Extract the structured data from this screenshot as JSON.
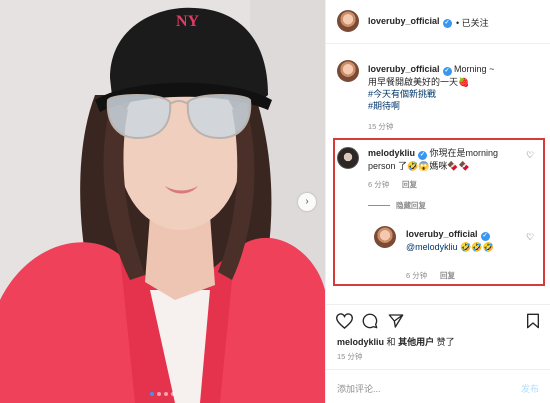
{
  "photo": {
    "colors": {
      "jacket": "#f0415a",
      "cap": "#1b1b1b",
      "cap_logo": "#e23a63",
      "hair": "#3a2620",
      "skin": "#f0cfbe",
      "background": "#e6e2e1"
    },
    "nav_icon": "chevron-right-icon",
    "slide_count": 4,
    "active_slide": 1
  },
  "header": {
    "username": "loveruby_official",
    "separator": "•",
    "follow_status": "已关注"
  },
  "caption": {
    "username": "loveruby_official",
    "lines": [
      "Morning ~",
      "用早餐開啟美好的一天🍓",
      "#今天有個新挑戰",
      "#期待啊"
    ],
    "time": "15 分钟"
  },
  "comments": [
    {
      "username": "melodykliu",
      "text_line1": "你現在是morning",
      "text_line2": "person 了🤣😱媽咪🍫🍫",
      "time": "6 分钟",
      "reply_label": "回复",
      "hide_replies": "隐藏回复"
    },
    {
      "username": "loveruby_official",
      "mention": "@melodykliu",
      "emoji": "🤣🤣🤣",
      "time": "6 分钟",
      "reply_label": "回复"
    }
  ],
  "actions": {
    "icons": [
      "heart-icon",
      "comment-icon",
      "share-icon",
      "bookmark-icon"
    ]
  },
  "likes": {
    "user": "melodykliu",
    "and": "和",
    "others": "其他用户",
    "liked": "赞了"
  },
  "post_time": "15 分钟",
  "comment_input": {
    "placeholder": "添加评论...",
    "post_label": "发布"
  },
  "highlight_color": "#d83a3a"
}
